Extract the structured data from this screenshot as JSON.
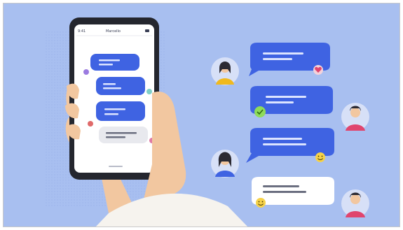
{
  "scene": {
    "phone": {
      "status_left": "9:41",
      "status_title": "Marcello",
      "message_count": 4
    },
    "conversation": {
      "message_count": 4,
      "reactions": [
        "heart-reaction",
        "check-reaction",
        "smile-reaction",
        "smile-reaction"
      ]
    },
    "colors": {
      "background": "#a8bff0",
      "bubble_blue": "#3f63e2",
      "bubble_gray": "#e8e9ee",
      "bubble_white": "#ffffff",
      "skin": "#f2c7a0",
      "sleeve": "#f6f3ee"
    }
  }
}
